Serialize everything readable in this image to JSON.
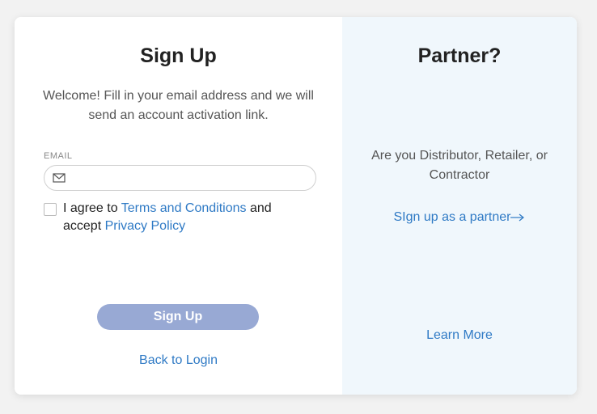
{
  "signup": {
    "title": "Sign Up",
    "welcome": "Welcome! Fill in your email address and we will send an account activation link.",
    "email_label": "EMAIL",
    "email_value": "",
    "email_placeholder": "",
    "agree_prefix": "I agree to ",
    "terms_link": "Terms and Conditions",
    "agree_middle": " and accept ",
    "privacy_link": "Privacy Policy",
    "button_label": "Sign Up",
    "back_link": "Back to Login"
  },
  "partner": {
    "title": "Partner?",
    "text": "Are you Distributor, Retailer, or Contractor",
    "signup_link": "SIgn up as a partner",
    "learn_more": "Learn More"
  },
  "icons": {
    "email": "envelope-icon",
    "partner_arrow": "arrow-right-icon"
  },
  "colors": {
    "link": "#2f7ac5",
    "button": "#98a9d4",
    "partner_bg": "#f0f7fc"
  }
}
